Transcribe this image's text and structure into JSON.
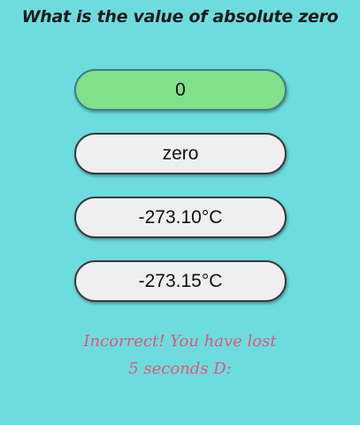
{
  "question": "What is the value of absolute zero",
  "answers": [
    {
      "label": "0",
      "state": "correct"
    },
    {
      "label": "zero",
      "state": "default"
    },
    {
      "label": "-273.10°C",
      "state": "default"
    },
    {
      "label": "-273.15°C",
      "state": "default"
    }
  ],
  "feedback": {
    "line1": "Incorrect! You have lost",
    "line2": "5 seconds D:"
  },
  "colors": {
    "background": "#6ddcde",
    "button": "#efefef",
    "highlight": "#82e08a",
    "feedback": "#e2557a"
  }
}
